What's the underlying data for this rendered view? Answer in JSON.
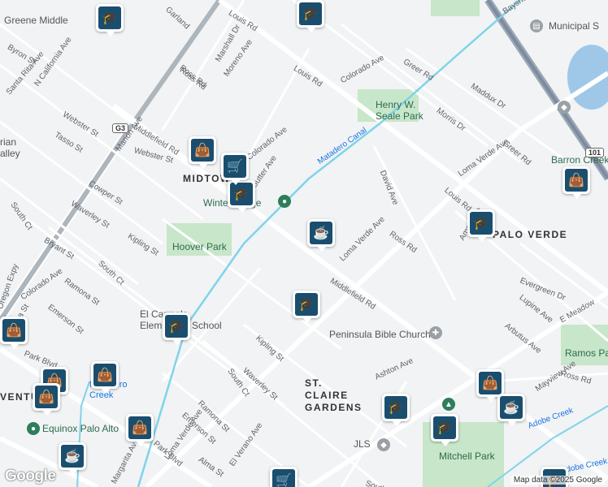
{
  "map": {
    "copyright": "Map data ©2025 Google",
    "logo": "Google",
    "street_labels": [
      {
        "text": "Louis Rd"
      },
      {
        "text": "Louis Rd"
      },
      {
        "text": "Louis Rd"
      },
      {
        "text": "Colorado Ave"
      },
      {
        "text": "Greer Rd"
      },
      {
        "text": "Maddux Dr"
      },
      {
        "text": "Morris Dr"
      },
      {
        "text": "Loma Verde Ave"
      },
      {
        "text": "Loma Verde Ave"
      },
      {
        "text": "Loma Verde Ave"
      },
      {
        "text": "Greer Rd"
      },
      {
        "text": "David Ave"
      },
      {
        "text": "Ross Rd"
      },
      {
        "text": "Ross Rd"
      },
      {
        "text": "Ross Rd"
      },
      {
        "text": "Ames Ave"
      },
      {
        "text": "Middlefield Rd"
      },
      {
        "text": "Middlefield Rd"
      },
      {
        "text": "Evergreen Dr"
      },
      {
        "text": "Lupine Ave"
      },
      {
        "text": "Arbutus Ave"
      },
      {
        "text": "Ashton Ave"
      },
      {
        "text": "Mayview Ave"
      },
      {
        "text": "E Meadow"
      },
      {
        "text": "Kipling St"
      },
      {
        "text": "Kipling St"
      },
      {
        "text": "Waverley St"
      },
      {
        "text": "Waverley St"
      },
      {
        "text": "South Ct"
      },
      {
        "text": "South Ct"
      },
      {
        "text": "South Ct"
      },
      {
        "text": "Ramona St"
      },
      {
        "text": "Ramona St"
      },
      {
        "text": "Emerson St"
      },
      {
        "text": "Emerson St"
      },
      {
        "text": "Alma St"
      },
      {
        "text": "Alma St"
      },
      {
        "text": "Park Blvd"
      },
      {
        "text": "Park Blvd"
      },
      {
        "text": "El Verano Ave"
      },
      {
        "text": "Bryant St"
      },
      {
        "text": "Colorado Ave"
      },
      {
        "text": "Cowper St"
      },
      {
        "text": "Marion Ave"
      },
      {
        "text": "Webster St"
      },
      {
        "text": "Webster St"
      },
      {
        "text": "Tasso St"
      },
      {
        "text": "N California Ave"
      },
      {
        "text": "Santa Rita Ave"
      },
      {
        "text": "Byron St"
      },
      {
        "text": "Garland"
      },
      {
        "text": "Marshall Dr"
      },
      {
        "text": "Moreno Ave"
      },
      {
        "text": "Ross Rd"
      },
      {
        "text": "Sutter Ave"
      },
      {
        "text": "Colorado Ave"
      },
      {
        "text": "Matadero Canal"
      },
      {
        "text": "Bayshore Fwy"
      },
      {
        "text": "Oregon Expy"
      },
      {
        "text": "South Co"
      },
      {
        "text": "Margarita Av"
      },
      {
        "text": "Adobe Creek"
      },
      {
        "text": "Adobe Creek"
      }
    ],
    "places": [
      {
        "text": "Henry W. Seale Park"
      },
      {
        "text": "Hoover Park"
      },
      {
        "text": "Winter Lodge"
      },
      {
        "text": "Peninsula Bible Church"
      },
      {
        "text": "El Carmelo Elementary School"
      },
      {
        "text": "Ramos Park"
      },
      {
        "text": "Mitchell Park"
      },
      {
        "text": "JLS"
      },
      {
        "text": "Barron Creek"
      },
      {
        "text": "Municipal S"
      },
      {
        "text": "Equinox Palo Alto"
      },
      {
        "text": "Greene Middle"
      },
      {
        "text": "rian"
      },
      {
        "text": "alley"
      },
      {
        "text": "Matadero Creek"
      }
    ],
    "areas": [
      {
        "text": "MIDTOWN"
      },
      {
        "text": "PALO VERDE"
      },
      {
        "text": "ST. CLAIRE GARDENS"
      },
      {
        "text": "VENTURA"
      }
    ],
    "highways": [
      {
        "text": "G3"
      },
      {
        "text": "101"
      }
    ],
    "markers": [
      {
        "icon": "school-icon"
      },
      {
        "icon": "school-icon"
      },
      {
        "icon": "school-icon"
      },
      {
        "icon": "school-icon"
      },
      {
        "icon": "school-icon"
      },
      {
        "icon": "school-icon"
      },
      {
        "icon": "school-icon"
      },
      {
        "icon": "school-icon"
      },
      {
        "icon": "shopping-bag-icon"
      },
      {
        "icon": "shopping-bag-icon"
      },
      {
        "icon": "shopping-bag-icon"
      },
      {
        "icon": "shopping-bag-icon"
      },
      {
        "icon": "shopping-bag-icon"
      },
      {
        "icon": "shopping-bag-icon"
      },
      {
        "icon": "shopping-bag-icon"
      },
      {
        "icon": "shopping-bag-icon"
      },
      {
        "icon": "coffee-icon"
      },
      {
        "icon": "coffee-icon"
      },
      {
        "icon": "coffee-icon"
      },
      {
        "icon": "cart-icon"
      },
      {
        "icon": "cart-icon"
      },
      {
        "icon": "school-icon"
      }
    ]
  }
}
